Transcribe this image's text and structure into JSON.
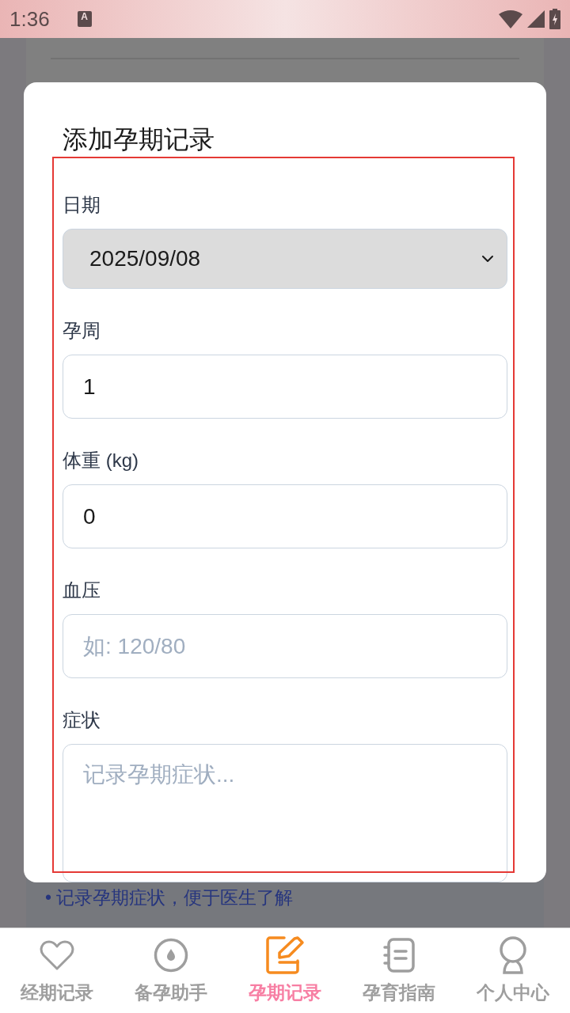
{
  "status_bar": {
    "time": "1:36",
    "notification_badge": "A"
  },
  "page": {
    "tips": [
      "• 记录孕期症状，便于医生了解"
    ]
  },
  "dialog": {
    "title": "添加孕期记录",
    "fields": [
      {
        "kind": "select",
        "label": "日期",
        "value": "2025/09/08"
      },
      {
        "kind": "input",
        "label": "孕周",
        "value": "1"
      },
      {
        "kind": "input",
        "label": "体重 (kg)",
        "value": "0"
      },
      {
        "kind": "input",
        "label": "血压",
        "placeholder": "如: 120/80"
      },
      {
        "kind": "textarea",
        "label": "症状",
        "placeholder": "记录孕期症状..."
      }
    ]
  },
  "bottom_nav": [
    {
      "label": "经期记录",
      "selected": false
    },
    {
      "label": "备孕助手",
      "selected": false
    },
    {
      "label": "孕期记录",
      "selected": true
    },
    {
      "label": "孕育指南",
      "selected": false
    },
    {
      "label": "个人中心",
      "selected": false
    }
  ]
}
